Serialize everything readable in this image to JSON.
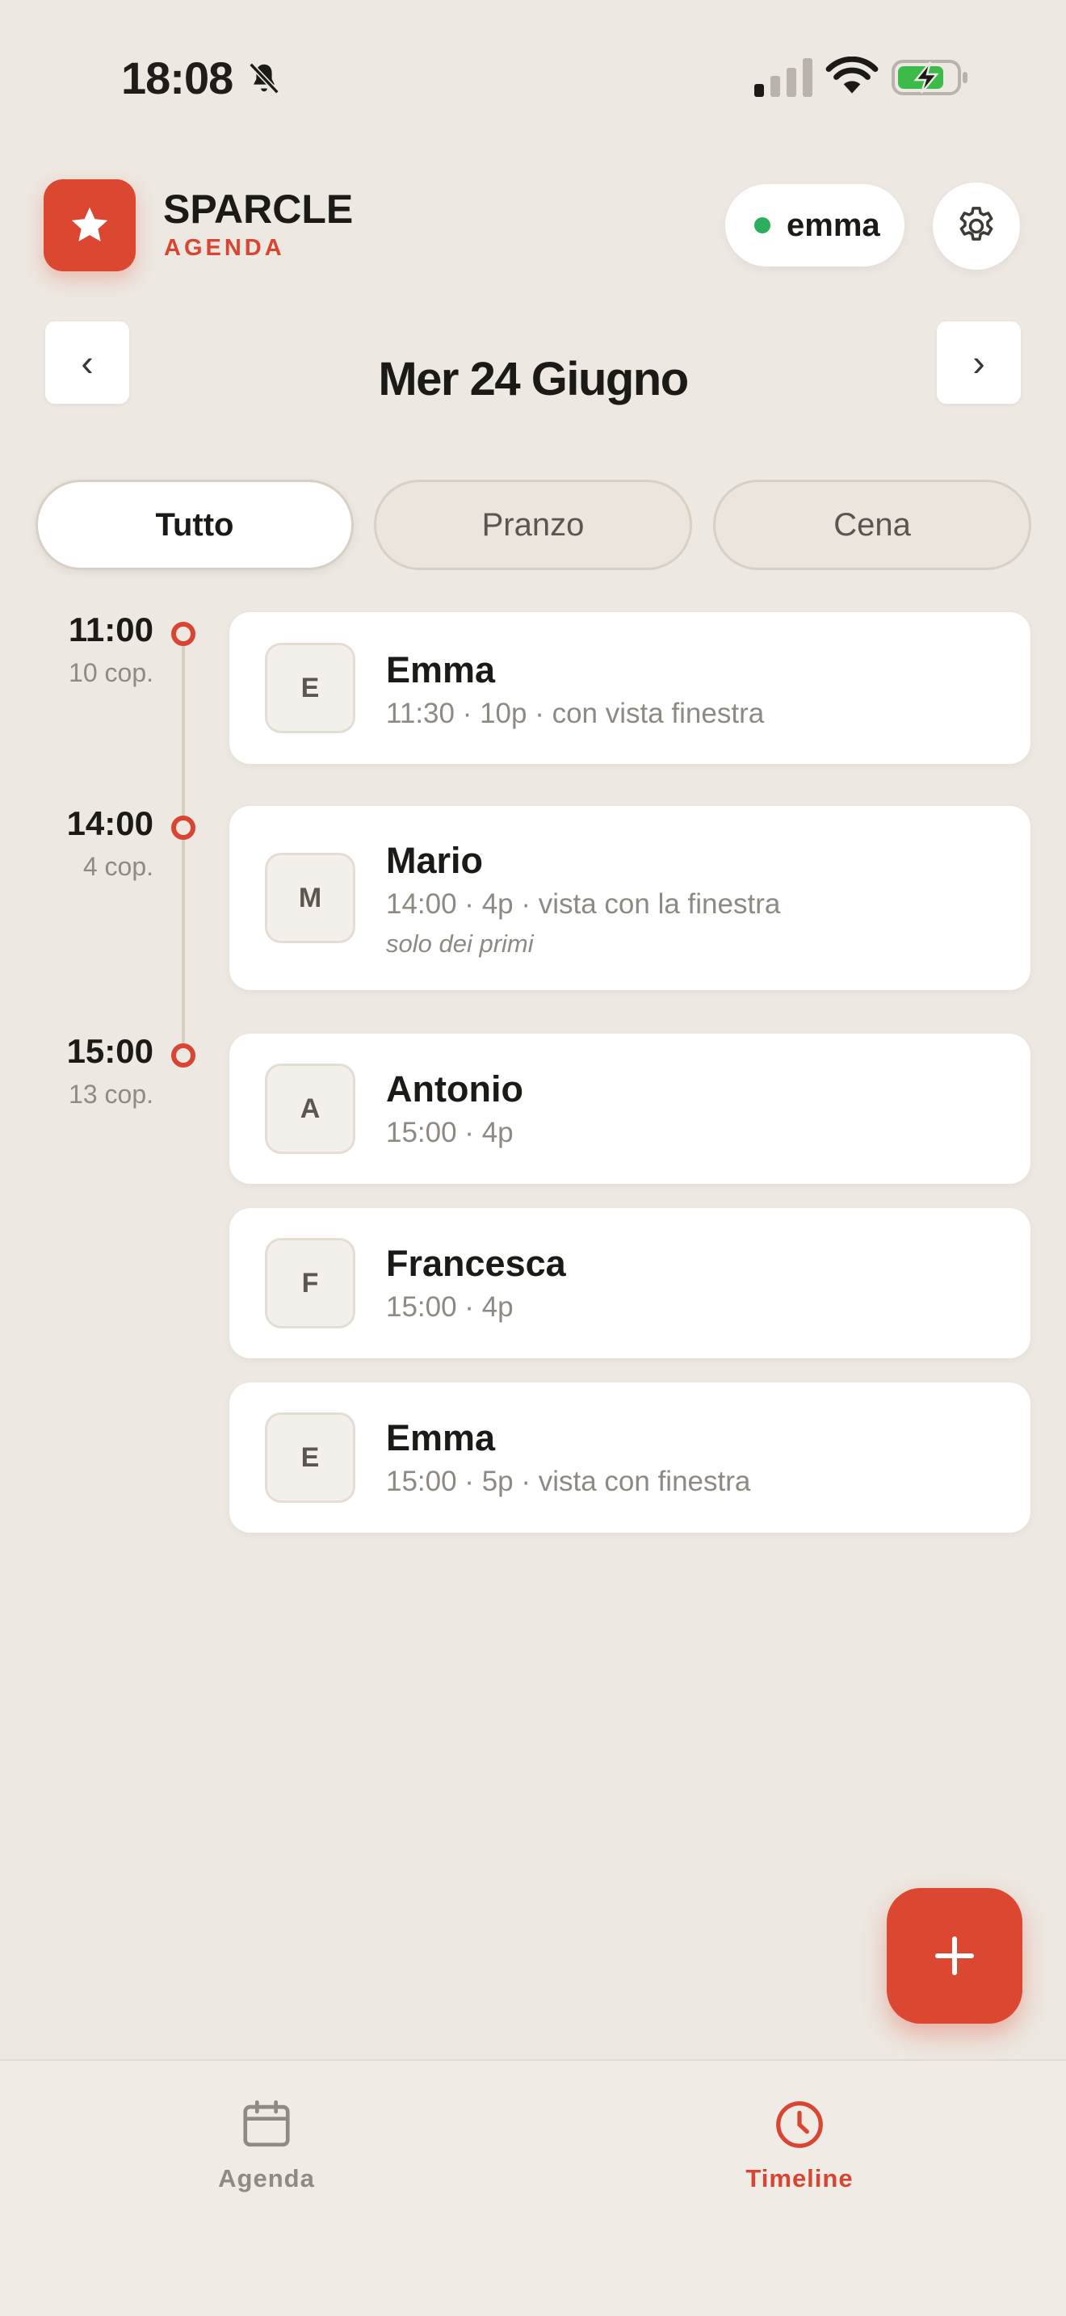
{
  "status_bar": {
    "time": "18:08"
  },
  "header": {
    "brand_title": "SPARCLE",
    "brand_subtitle": "AGENDA",
    "user_name": "emma",
    "accent_color": "#dc4732",
    "online_color": "#2cae5c"
  },
  "date_nav": {
    "prev_label": "‹",
    "next_label": "›",
    "date_title": "Mer 24 Giugno"
  },
  "tabs": [
    {
      "label": "Tutto",
      "active": true
    },
    {
      "label": "Pranzo",
      "active": false
    },
    {
      "label": "Cena",
      "active": false
    }
  ],
  "slots": [
    {
      "time": "11:00",
      "covers": "10 cop."
    },
    {
      "time": "14:00",
      "covers": "4 cop."
    },
    {
      "time": "15:00",
      "covers": "13 cop."
    }
  ],
  "reservations": [
    {
      "initial": "E",
      "name": "Emma",
      "detail": "11:30 · 10p · con vista finestra",
      "note": ""
    },
    {
      "initial": "M",
      "name": "Mario",
      "detail": "14:00 · 4p · vista con la finestra",
      "note": "solo dei primi"
    },
    {
      "initial": "A",
      "name": "Antonio",
      "detail": "15:00 · 4p",
      "note": ""
    },
    {
      "initial": "F",
      "name": "Francesca",
      "detail": "15:00 · 4p",
      "note": ""
    },
    {
      "initial": "E",
      "name": "Emma",
      "detail": "15:00 · 5p · vista con finestra",
      "note": ""
    }
  ],
  "fab": {
    "icon": "plus-icon"
  },
  "bottom_nav": {
    "items": [
      {
        "label": "Agenda",
        "icon": "calendar-icon",
        "active": false
      },
      {
        "label": "Timeline",
        "icon": "clock-icon",
        "active": true
      }
    ]
  }
}
